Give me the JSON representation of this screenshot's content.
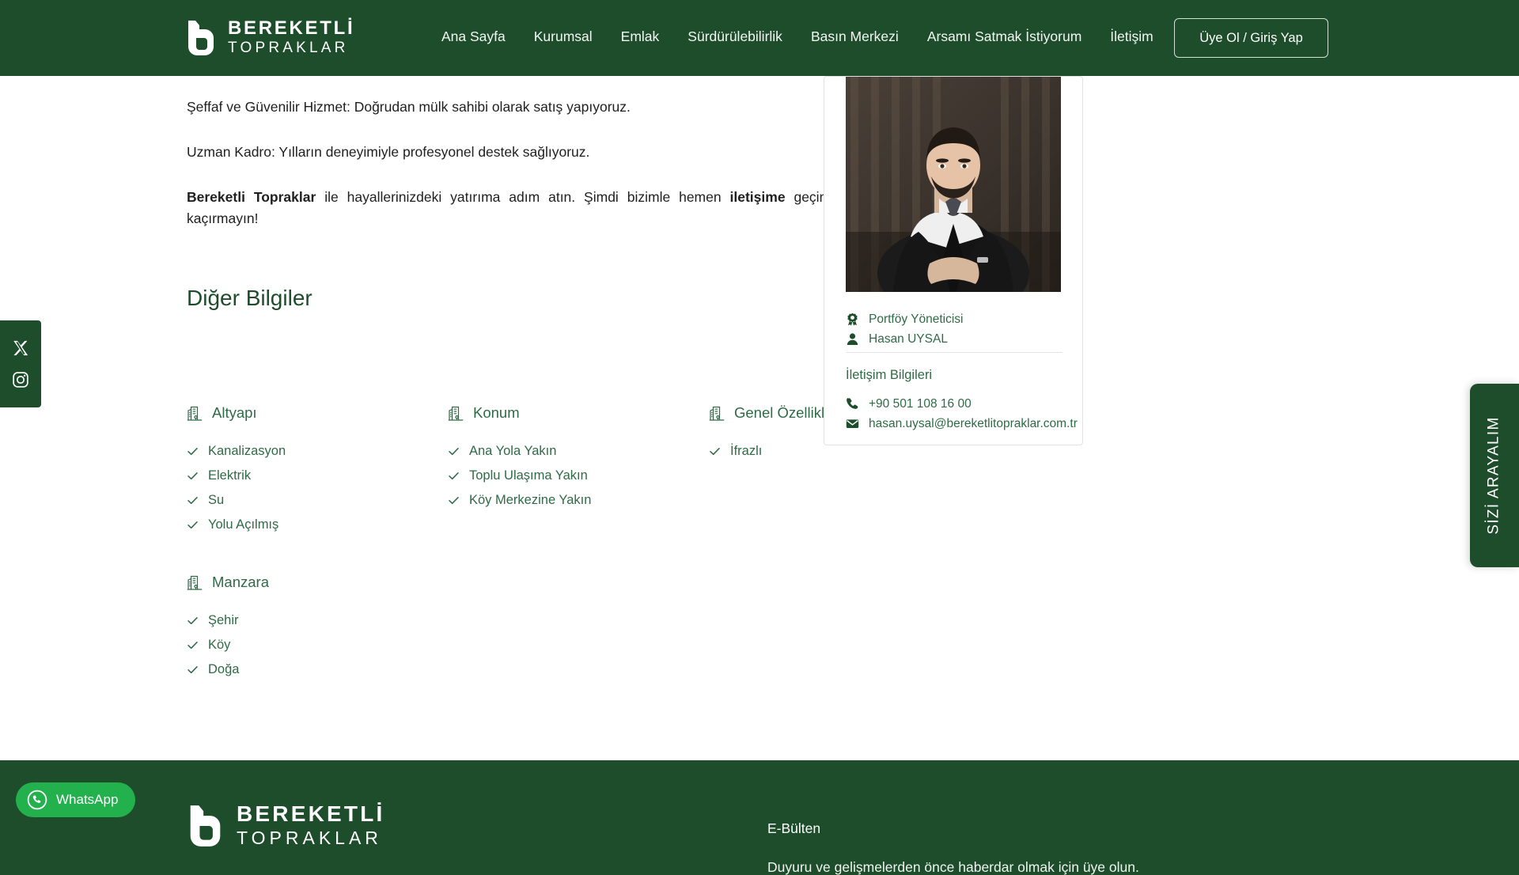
{
  "brand": {
    "line1": "BEREKETLİ",
    "line2": "TOPRAKLAR"
  },
  "header": {
    "nav": [
      {
        "label": "Ana Sayfa"
      },
      {
        "label": "Kurumsal"
      },
      {
        "label": "Emlak"
      },
      {
        "label": "Sürdürülebilirlik"
      },
      {
        "label": "Basın Merkezi"
      },
      {
        "label": "Arsamı Satmak İstiyorum"
      },
      {
        "label": "İletişim"
      }
    ],
    "login_label": "Üye Ol / Giriş Yap",
    "bg_color": "#1d4d2b"
  },
  "main": {
    "paragraphs": [
      {
        "text": "Şeffaf ve Güvenilir Hizmet: Doğrudan mülk sahibi olarak satış yapıyoruz."
      },
      {
        "text": "Uzman Kadro: Yılların deneyimiyle profesyonel destek sağlıyoruz."
      }
    ],
    "cta_paragraph": {
      "bold1": "Bereketli Topraklar",
      "mid": " ile hayallerinizdeki yatırıma adım atın. Şimdi bizimle hemen ",
      "bold2": "iletişime",
      "tail": " geçin, bu eşsiz fırsatı kaçırmayın!"
    },
    "section_title": "Diğer Bilgiler",
    "feature_groups": [
      {
        "icon": "building-icon",
        "title": "Altyapı",
        "items": [
          "Kanalizasyon",
          "Elektrik",
          "Su",
          "Yolu Açılmış"
        ]
      },
      {
        "icon": "building-icon",
        "title": "Konum",
        "items": [
          "Ana Yola Yakın",
          "Toplu Ulaşıma Yakın",
          "Köy Merkezine Yakın"
        ]
      },
      {
        "icon": "building-icon",
        "title": "Genel Özellikler",
        "items": [
          "İfrazlı"
        ]
      },
      {
        "icon": "building-icon",
        "title": "Manzara",
        "items": [
          "Şehir",
          "Köy",
          "Doğa"
        ]
      }
    ]
  },
  "agent_card": {
    "role_icon": "badge-icon",
    "role": "Portföy Yöneticisi",
    "name_icon": "person-icon",
    "name": "Hasan UYSAL",
    "contact_title": "İletişim Bilgileri",
    "phone_icon": "phone-icon",
    "phone": "+90 501 108 16 00",
    "email_icon": "mail-icon",
    "email": "hasan.uysal@bereketlitopraklar.com.tr"
  },
  "social_rail": {
    "items": [
      {
        "icon": "x-twitter-icon",
        "label": "X"
      },
      {
        "icon": "instagram-icon",
        "label": "Instagram"
      }
    ]
  },
  "call_tab": {
    "label": "SİZİ ARAYALIM"
  },
  "whatsapp": {
    "icon": "whatsapp-icon",
    "label": "WhatsApp",
    "color": "#22b14c"
  },
  "footer": {
    "newsletter_title": "E-Bülten",
    "newsletter_sub": "Duyuru ve gelişmelerden önce haberdar olmak için üye olun."
  },
  "colors": {
    "brand_green": "#1d4d2b",
    "text_green": "#2e6b46",
    "whatsapp_green": "#22b14c"
  }
}
